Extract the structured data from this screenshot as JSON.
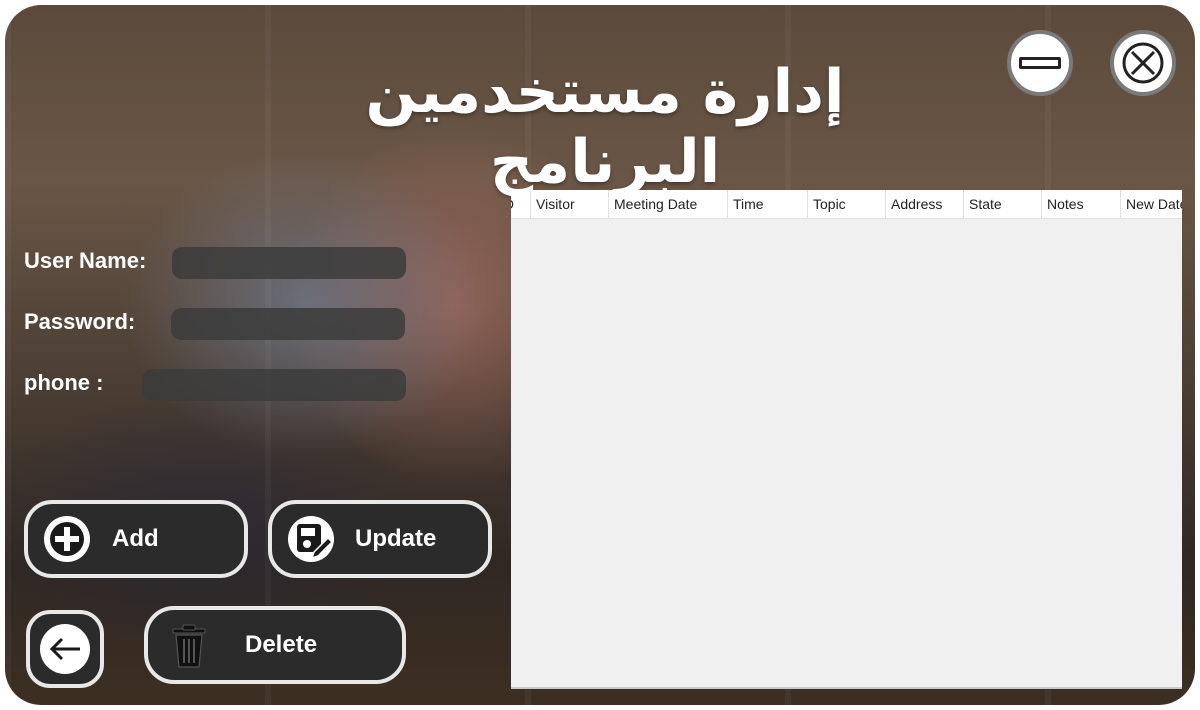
{
  "window": {
    "title": "إدارة مستخدمين البرنامج"
  },
  "form": {
    "username_label": "User Name:",
    "username_value": "",
    "password_label": "Password:",
    "password_value": "",
    "phone_label": "phone :",
    "phone_value": ""
  },
  "buttons": {
    "add_label": "Add",
    "update_label": "Update",
    "delete_label": "Delete"
  },
  "table": {
    "columns": [
      "ID",
      "Visitor",
      "Meeting Date",
      "Time",
      "Topic",
      "Address",
      "State",
      "Notes",
      "New Date"
    ],
    "rows": []
  },
  "colors": {
    "button_bg": "#2b2b2b",
    "button_border": "#e8e8e8",
    "field_bg": "#3c3c3c",
    "table_bg": "#f0f0f0"
  }
}
